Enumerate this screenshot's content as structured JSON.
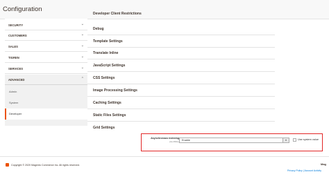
{
  "header": {
    "title": "Configuration"
  },
  "sidebar": {
    "sections": [
      {
        "label": "SECURITY",
        "chevron": "chevron-down-icon"
      },
      {
        "label": "CUSTOMERS",
        "chevron": "chevron-down-icon"
      },
      {
        "label": "SALES",
        "chevron": "chevron-down-icon"
      },
      {
        "label": "TIGREN",
        "chevron": "chevron-down-icon"
      },
      {
        "label": "SERVICES",
        "chevron": "chevron-down-icon"
      },
      {
        "label": "ADVANCED",
        "chevron": "chevron-up-icon"
      }
    ],
    "advanced_items": [
      {
        "label": "Admin"
      },
      {
        "label": "System"
      },
      {
        "label": "Developer"
      }
    ],
    "active_item": "Developer"
  },
  "main": {
    "rows": [
      {
        "label": "Developer Client Restrictions"
      },
      {
        "label": "Debug"
      },
      {
        "label": "Template Settings"
      },
      {
        "label": "Translate Inline"
      },
      {
        "label": "JavaScript Settings"
      },
      {
        "label": "CSS Settings"
      },
      {
        "label": "Image Processing Settings"
      },
      {
        "label": "Caching Settings"
      },
      {
        "label": "Static Files Settings"
      },
      {
        "label": "Grid Settings"
      }
    ],
    "grid": {
      "field_label": "Asynchronous indexing",
      "field_scope": "[GLOBAL]",
      "select_value": "Enable",
      "checkbox_label": "Use system value",
      "checkbox_checked": false
    }
  },
  "footer": {
    "copyright": "Copyright © 2020 Magento Commerce Inc. All rights reserved.",
    "brand": "Mag",
    "legal": "Privacy Policy | Account Activity"
  },
  "colors": {
    "accent": "#eb5202",
    "highlight": "#e22626",
    "link": "#007bdb"
  }
}
